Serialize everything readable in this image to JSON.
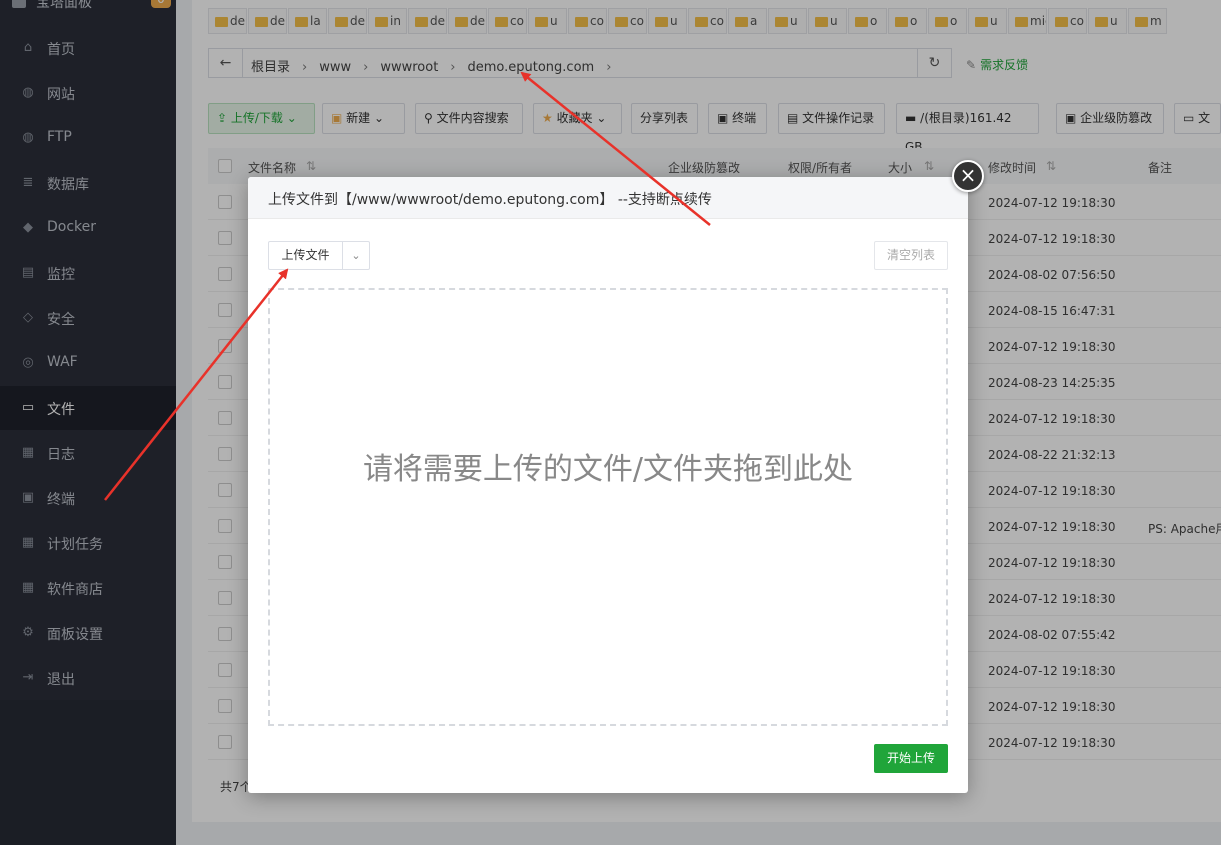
{
  "sidebar": {
    "brand": "宝塔面板",
    "badge": "0",
    "items": [
      {
        "label": "首页",
        "icon": "home-icon",
        "glyph": "⌂"
      },
      {
        "label": "网站",
        "icon": "globe-icon",
        "glyph": "◍"
      },
      {
        "label": "FTP",
        "icon": "ftp-icon",
        "glyph": "◍"
      },
      {
        "label": "数据库",
        "icon": "database-icon",
        "glyph": "≣"
      },
      {
        "label": "Docker",
        "icon": "docker-icon",
        "glyph": "◆"
      },
      {
        "label": "监控",
        "icon": "monitor-icon",
        "glyph": "▤"
      },
      {
        "label": "安全",
        "icon": "shield-icon",
        "glyph": "◇"
      },
      {
        "label": "WAF",
        "icon": "waf-icon",
        "glyph": "◎"
      },
      {
        "label": "文件",
        "icon": "folder-icon",
        "glyph": "▭"
      },
      {
        "label": "日志",
        "icon": "log-icon",
        "glyph": "▦"
      },
      {
        "label": "终端",
        "icon": "terminal-icon",
        "glyph": "▣"
      },
      {
        "label": "计划任务",
        "icon": "calendar-icon",
        "glyph": "▦"
      },
      {
        "label": "软件商店",
        "icon": "apps-icon",
        "glyph": "▦"
      },
      {
        "label": "面板设置",
        "icon": "settings-icon",
        "glyph": "⚙"
      },
      {
        "label": "退出",
        "icon": "logout-icon",
        "glyph": "⇥"
      }
    ],
    "active": "文件"
  },
  "dir_chips": [
    "de",
    "de",
    "la",
    "de",
    "in",
    "de",
    "de",
    "co",
    "u",
    "co",
    "co",
    "u",
    "co",
    "a",
    "u",
    "u",
    "o",
    "o",
    "o",
    "u",
    "mic",
    "co",
    "u",
    "m"
  ],
  "breadcrumb": {
    "items": [
      "根目录",
      "www",
      "wwwroot",
      "demo.eputong.com"
    ],
    "feedback": "需求反馈"
  },
  "toolbar": {
    "upload_download": "上传/下载",
    "new": "新建",
    "content_search": "文件内容搜索",
    "favorites": "收藏夹",
    "share_list": "分享列表",
    "terminal": "终端",
    "op_log": "文件操作记录",
    "disk": "/(根目录)161.42 GB",
    "tamper": "企业级防篡改",
    "more": "文"
  },
  "table": {
    "headers": {
      "name": "文件名称",
      "tamper": "企业级防篡改",
      "perm": "权限/所有者",
      "size": "大小",
      "mtime": "修改时间",
      "note": "备注"
    },
    "rows": [
      {
        "time": "2024-07-12 19:18:30",
        "note": ""
      },
      {
        "time": "2024-07-12 19:18:30",
        "note": ""
      },
      {
        "time": "2024-08-02 07:56:50",
        "note": ""
      },
      {
        "time": "2024-08-15 16:47:31",
        "note": ""
      },
      {
        "time": "2024-07-12 19:18:30",
        "note": ""
      },
      {
        "time": "2024-08-23 14:25:35",
        "note": ""
      },
      {
        "time": "2024-07-12 19:18:30",
        "note": ""
      },
      {
        "time": "2024-08-22 21:32:13",
        "note": ""
      },
      {
        "time": "2024-07-12 19:18:30",
        "note": ""
      },
      {
        "time": "2024-07-12 19:18:30",
        "note": "PS: Apache用"
      },
      {
        "time": "2024-07-12 19:18:30",
        "note": ""
      },
      {
        "time": "2024-07-12 19:18:30",
        "note": ""
      },
      {
        "time": "2024-08-02 07:55:42",
        "note": ""
      },
      {
        "time": "2024-07-12 19:18:30",
        "note": ""
      },
      {
        "time": "2024-07-12 19:18:30",
        "note": ""
      },
      {
        "time": "2024-07-12 19:18:30",
        "note": ""
      }
    ],
    "footer": "共7个"
  },
  "modal": {
    "title": "上传文件到【/www/wwwroot/demo.eputong.com】 --支持断点续传",
    "upload_file": "上传文件",
    "clear_list": "清空列表",
    "drop_hint": "请将需要上传的文件/文件夹拖到此处",
    "start_upload": "开始上传"
  },
  "colors": {
    "sidebar_bg": "#2b2f3a",
    "accent_green": "#20a53a",
    "annotation_red": "#e8322a"
  }
}
